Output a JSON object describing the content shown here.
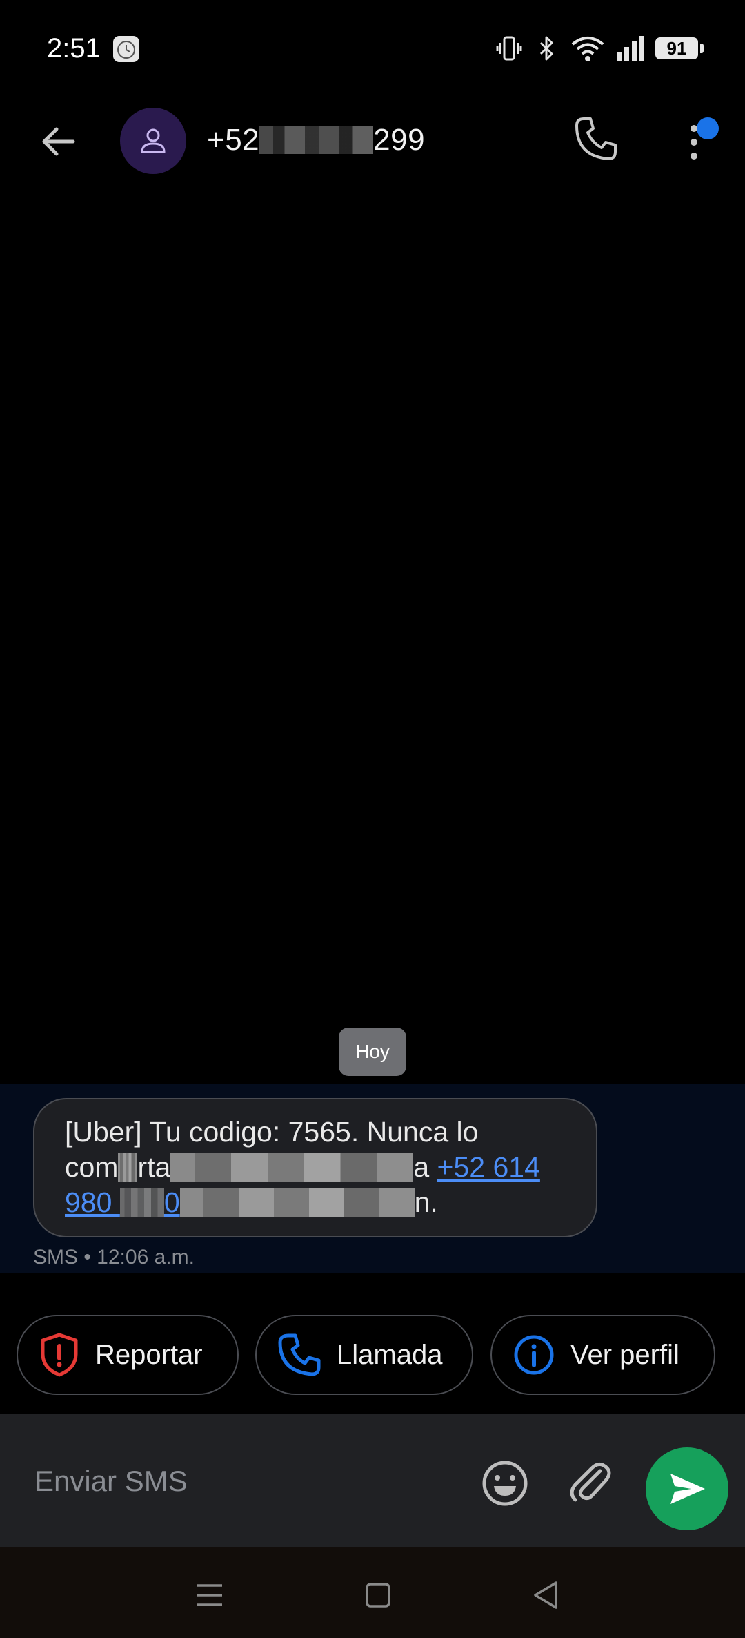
{
  "status_bar": {
    "time": "2:51",
    "battery_level": "91",
    "icons": [
      "alarm-clock-icon",
      "vibrate-icon",
      "bluetooth-icon",
      "wifi-icon",
      "cell-signal-icon",
      "battery-icon"
    ]
  },
  "header": {
    "contact_prefix": "+52",
    "contact_suffix": "299",
    "icons": [
      "back-arrow-icon",
      "person-icon",
      "phone-icon",
      "more-vert-icon"
    ],
    "colors": {
      "avatar_bg": "#2a1a4e",
      "notification_dot": "#1a73e8"
    }
  },
  "conversation": {
    "date_label": "Hoy",
    "message": {
      "line1": "[Uber] Tu codigo: 7565. Nunca lo",
      "line2_start": "com",
      "line2_mid": "rta",
      "line2_end": "a",
      "link_part1": "+52 614",
      "link_part2": "980 ",
      "link_part3": "0",
      "line3_end": "n."
    },
    "meta": "SMS • 12:06 a.m."
  },
  "actions": {
    "report_label": "Reportar",
    "call_label": "Llamada",
    "profile_label": "Ver perfil",
    "colors": {
      "report": "#e53935",
      "call": "#1a73e8",
      "profile": "#1a73e8"
    }
  },
  "composer": {
    "placeholder": "Enviar SMS",
    "send_color": "#16a05b"
  },
  "nav_bar": {
    "icons": [
      "recents-icon",
      "home-icon",
      "back-icon"
    ]
  }
}
